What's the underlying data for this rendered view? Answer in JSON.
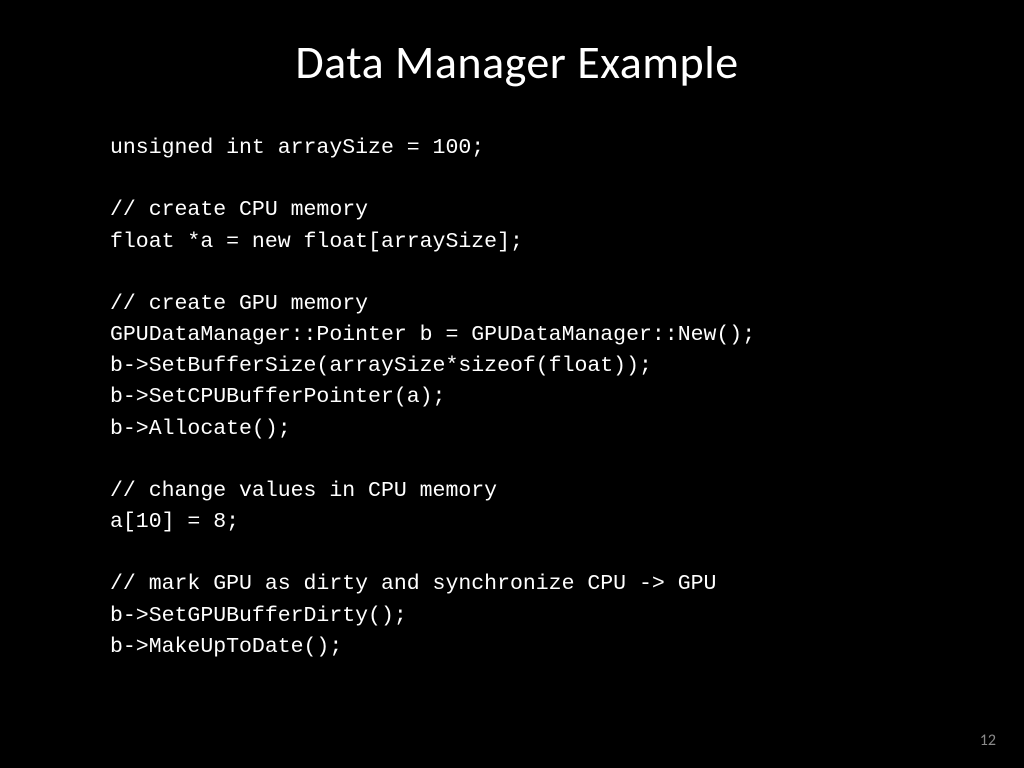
{
  "slide": {
    "title": "Data Manager Example",
    "code": "unsigned int arraySize = 100;\n\n// create CPU memory\nfloat *a = new float[arraySize];\n\n// create GPU memory\nGPUDataManager::Pointer b = GPUDataManager::New();\nb->SetBufferSize(arraySize*sizeof(float));\nb->SetCPUBufferPointer(a);\nb->Allocate();\n\n// change values in CPU memory\na[10] = 8;\n\n// mark GPU as dirty and synchronize CPU -> GPU\nb->SetGPUBufferDirty();\nb->MakeUpToDate();",
    "page_number": "12"
  }
}
